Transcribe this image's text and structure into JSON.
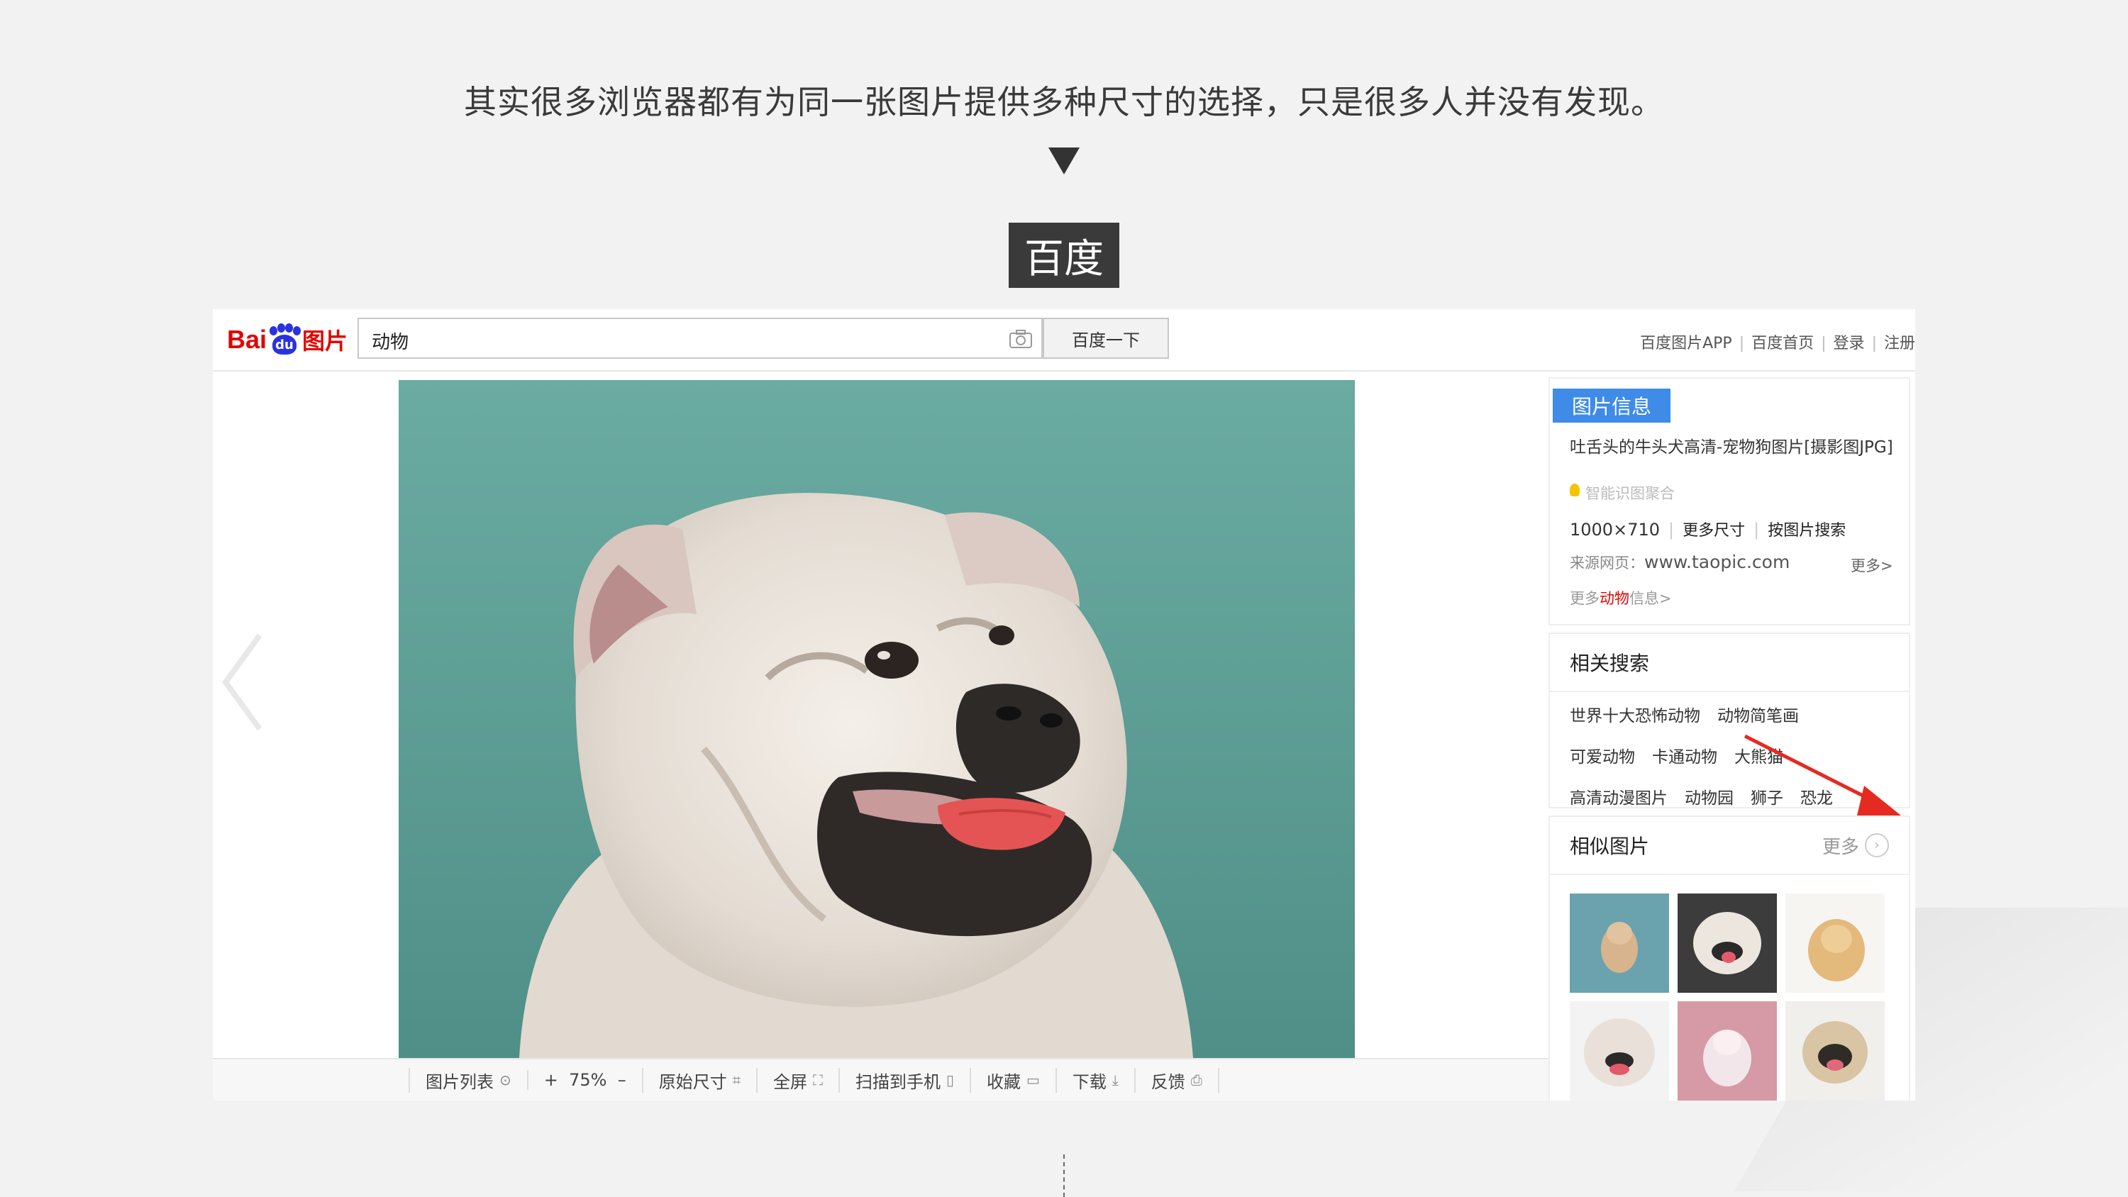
{
  "headline": "其实很多浏览器都有为同一张图片提供多种尺寸的选择，只是很多人并没有发现。",
  "site_tag": "百度",
  "screenshot": {
    "logo": {
      "bai": "Bai",
      "du": "du",
      "pic": "图片"
    },
    "search": {
      "query": "动物",
      "button": "百度一下"
    },
    "toplinks": [
      "百度图片APP",
      "百度首页",
      "登录",
      "注册"
    ],
    "bottom_toolbar": [
      {
        "label": "图片列表",
        "icon": "up-circle-icon"
      },
      {
        "label": "+  75%  –",
        "icon": ""
      },
      {
        "label": "原始尺寸",
        "icon": "resize-icon"
      },
      {
        "label": "全屏",
        "icon": "fullscreen-icon"
      },
      {
        "label": "扫描到手机",
        "icon": "phone-icon"
      },
      {
        "label": "收藏",
        "icon": "folder-icon"
      },
      {
        "label": "下载",
        "icon": "download-icon"
      },
      {
        "label": "反馈",
        "icon": "feedback-icon"
      }
    ],
    "image_info": {
      "tag": "图片信息",
      "title": "吐舌头的牛头犬高清-宠物狗图片[摄影图JPG]",
      "ai_text": "智能识图聚合",
      "size": "1000×710",
      "more_sizes": "更多尺寸",
      "search_by_image": "按图片搜索",
      "source_label": "来源网页：",
      "source_url": "www.taopic.com",
      "more": "更多>",
      "more_info_prefix": "更多",
      "more_info_kw": "动物",
      "more_info_suffix": "信息>"
    },
    "related": {
      "title": "相关搜索",
      "rows": [
        [
          "世界十大恐怖动物",
          "动物简笔画"
        ],
        [
          "可爱动物",
          "卡通动物",
          "大熊猫"
        ],
        [
          "高清动漫图片",
          "动物园",
          "狮子",
          "恐龙"
        ]
      ]
    },
    "similar": {
      "title": "相似图片",
      "more": "更多"
    },
    "colors": {
      "brand_red": "#e10602",
      "brand_blue": "#2932e1",
      "info_tag": "#3e8be8",
      "photo_bg": "#5fa39a"
    }
  }
}
